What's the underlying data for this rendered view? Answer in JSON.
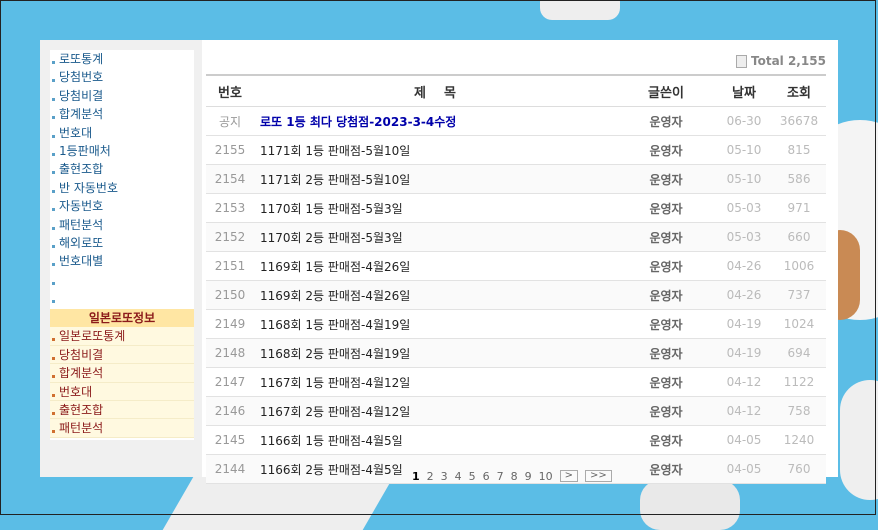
{
  "sidebar": {
    "items": [
      "로또통계",
      "당첨번호",
      "당첨비결",
      "합계분석",
      "번호대",
      "1등판매처",
      "출현조합",
      "반 자동번호",
      "자동번호",
      "패턴분석",
      "해외로또",
      "번호대별",
      "",
      ""
    ],
    "jp_header": "일본로또정보",
    "jp_items": [
      "일본로또통계",
      "당첨비결",
      "합계분석",
      "번호대",
      "출현조합",
      "패턴분석"
    ]
  },
  "total_label": "Total 2,155",
  "table": {
    "headers": {
      "num": "번호",
      "title": "제    목",
      "writer": "글쓴이",
      "date": "날짜",
      "hits": "조회"
    },
    "rows": [
      {
        "num": "공지",
        "title": "로또 1등 최다 당첨점-2023-3-4수정",
        "writer": "운영자",
        "date": "06-30",
        "hits": "36678"
      },
      {
        "num": "2155",
        "title": "1171회 1등 판매점-5월10일",
        "writer": "운영자",
        "date": "05-10",
        "hits": "815"
      },
      {
        "num": "2154",
        "title": "1171회 2등 판매점-5월10일",
        "writer": "운영자",
        "date": "05-10",
        "hits": "586"
      },
      {
        "num": "2153",
        "title": "1170회 1등 판매점-5월3일",
        "writer": "운영자",
        "date": "05-03",
        "hits": "971"
      },
      {
        "num": "2152",
        "title": "1170회 2등 판매점-5월3일",
        "writer": "운영자",
        "date": "05-03",
        "hits": "660"
      },
      {
        "num": "2151",
        "title": "1169회 1등 판매점-4월26일",
        "writer": "운영자",
        "date": "04-26",
        "hits": "1006"
      },
      {
        "num": "2150",
        "title": "1169회 2등 판매점-4월26일",
        "writer": "운영자",
        "date": "04-26",
        "hits": "737"
      },
      {
        "num": "2149",
        "title": "1168회 1등 판매점-4월19일",
        "writer": "운영자",
        "date": "04-19",
        "hits": "1024"
      },
      {
        "num": "2148",
        "title": "1168회 2등 판매점-4월19일",
        "writer": "운영자",
        "date": "04-19",
        "hits": "694"
      },
      {
        "num": "2147",
        "title": "1167회 1등 판매점-4월12일",
        "writer": "운영자",
        "date": "04-12",
        "hits": "1122"
      },
      {
        "num": "2146",
        "title": "1167회 2등 판매점-4월12일",
        "writer": "운영자",
        "date": "04-12",
        "hits": "758"
      },
      {
        "num": "2145",
        "title": "1166회 1등 판매점-4월5일",
        "writer": "운영자",
        "date": "04-05",
        "hits": "1240"
      },
      {
        "num": "2144",
        "title": "1166회 2등 판매점-4월5일",
        "writer": "운영자",
        "date": "04-05",
        "hits": "760"
      }
    ]
  },
  "pager": {
    "pages": [
      "1",
      "2",
      "3",
      "4",
      "5",
      "6",
      "7",
      "8",
      "9",
      "10"
    ],
    "current": "1",
    "next": ">",
    "last": ">>"
  }
}
